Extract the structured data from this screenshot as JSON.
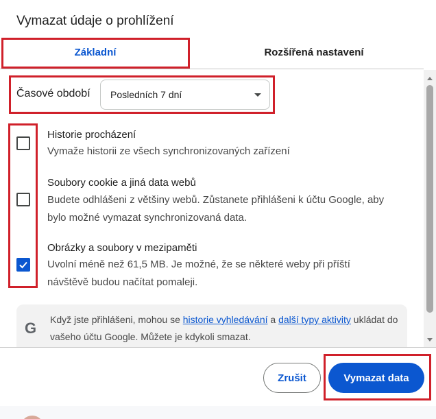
{
  "dialog": {
    "title": "Vymazat údaje o prohlížení"
  },
  "tabs": [
    {
      "label": "Základní",
      "active": true
    },
    {
      "label": "Rozšířená nastavení",
      "active": false
    }
  ],
  "time_range": {
    "label": "Časové období",
    "selected": "Posledních 7 dní"
  },
  "options": [
    {
      "title": "Historie procházení",
      "desc": "Vymaže historii ze všech synchronizovaných zařízení",
      "checked": false
    },
    {
      "title": "Soubory cookie a jiná data webů",
      "desc": "Budete odhlášeni z většiny webů. Zůstanete přihlášeni k účtu Google, aby bylo možné vymazat synchronizovaná data.",
      "checked": false
    },
    {
      "title": "Obrázky a soubory v mezipaměti",
      "desc": "Uvolní méně než 61,5 MB. Je možné, že se některé weby při příští návštěvě budou načítat pomaleji.",
      "checked": true
    }
  ],
  "info": {
    "icon_letter": "G",
    "text_before": "Když jste přihlášeni, mohou se ",
    "link1": "historie vyhledávání",
    "text_mid": " a ",
    "link2": "další typy aktivity",
    "text_after": " ukládat do vašeho účtu Google. Můžete je kdykoli smazat."
  },
  "buttons": {
    "cancel": "Zrušit",
    "clear": "Vymazat data"
  },
  "colors": {
    "accent": "#0b57d0",
    "highlight": "#d0202a"
  }
}
